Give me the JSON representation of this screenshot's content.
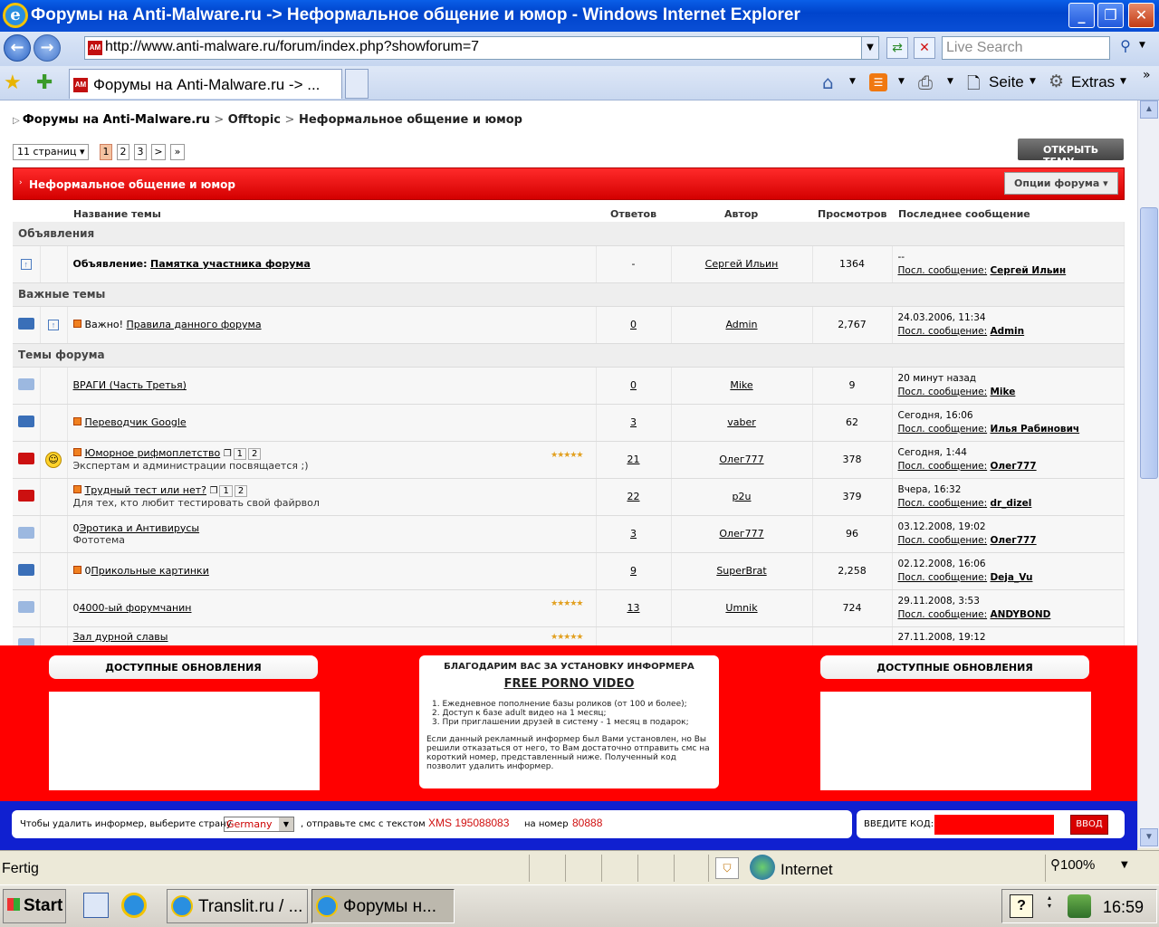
{
  "window": {
    "title": "Форумы на Anti-Malware.ru -> Неформальное общение и юмор - Windows Internet Explorer"
  },
  "address": {
    "url": "http://www.anti-malware.ru/forum/index.php?showforum=7",
    "search_placeholder": "Live Search"
  },
  "tabs": {
    "active": "Форумы на Anti-Malware.ru -> ..."
  },
  "commandbar": {
    "page": "Seite",
    "tools": "Extras"
  },
  "breadcrumb": {
    "root": "Форумы на Anti-Malware.ru",
    "sep": ">",
    "mid": "Offtopic",
    "current": "Неформальное общение и юмор"
  },
  "pagination": {
    "pages": "11 страниц",
    "items": [
      "1",
      "2",
      "3",
      ">",
      "»"
    ]
  },
  "new_topic": "ОТКРЫТЬ ТЕМУ",
  "forum": {
    "title": "Неформальное общение и юмор",
    "options": "Опции форума"
  },
  "columns": {
    "topic": "Название темы",
    "replies": "Ответов",
    "author": "Автор",
    "views": "Просмотров",
    "last": "Последнее сообщение"
  },
  "sections": {
    "announce": "Объявления",
    "important": "Важные темы",
    "topics": "Темы форума"
  },
  "last_label": "Посл. сообщение:",
  "announcement": {
    "prefix": "Объявление:",
    "title": "Памятка участника форума",
    "replies": "-",
    "author": "Сергей Ильин",
    "views": "1364",
    "date": "--",
    "last_by": "Сергей Ильин"
  },
  "pinned": {
    "prefix": "Важно!",
    "title": "Правила данного форума",
    "replies": "0",
    "author": "Admin",
    "views": "2,767",
    "date": "24.03.2006, 11:34",
    "last_by": "Admin"
  },
  "topics": [
    {
      "title": "ВРАГИ (Часть Третья)",
      "sub": "",
      "replies": "0",
      "author": "Mike",
      "views": "9",
      "date": "20 минут назад",
      "last_by": "Mike"
    },
    {
      "title": "Переводчик Google",
      "sub": "",
      "replies": "3",
      "author": "vaber",
      "views": "62",
      "date": "Сегодня, 16:06",
      "last_by": "Илья Рабинович"
    },
    {
      "title": "Юморное рифмоплетство",
      "sub": "Экспертам и администрации посвящается ;)",
      "replies": "21",
      "author": "Олег777",
      "views": "378",
      "date": "Сегодня, 1:44",
      "last_by": "Олег777",
      "pages": [
        "1",
        "2"
      ]
    },
    {
      "title": "Трудный тест или нет?",
      "sub": "Для тех, кто любит тестировать свой файрвол",
      "replies": "22",
      "author": "p2u",
      "views": "379",
      "date": "Вчера, 16:32",
      "last_by": "dr_dizel",
      "pages": [
        "1",
        "2"
      ]
    },
    {
      "title": "Эротика и Антивирусы",
      "sub": "Фототема",
      "replies": "3",
      "author": "Олег777",
      "views": "96",
      "date": "03.12.2008, 19:02",
      "last_by": "Олег777"
    },
    {
      "title": "Прикольные картинки",
      "sub": "",
      "replies": "9",
      "author": "SuperBrat",
      "views": "2,258",
      "date": "02.12.2008, 16:06",
      "last_by": "Deja_Vu"
    },
    {
      "title": "4000-ый форумчанин",
      "sub": "",
      "replies": "13",
      "author": "Umnik",
      "views": "724",
      "date": "29.11.2008, 3:53",
      "last_by": "ANDYBOND"
    },
    {
      "title": "Зал дурной славы",
      "sub": "",
      "replies": "",
      "author": "",
      "views": "",
      "date": "27.11.2008, 19:12",
      "last_by": ""
    }
  ],
  "informer": {
    "left_title": "ДОСТУПНЫЕ ОБНОВЛЕНИЯ",
    "right_title": "ДОСТУПНЫЕ ОБНОВЛЕНИЯ",
    "center_title": "БЛАГОДАРИМ ВАС ЗА УСТАНОВКУ ИНФОРМЕРА",
    "center_link": "FREE PORNO VIDEO",
    "list": [
      "1. Ежедневное пополнение базы роликов (от 100 и более);",
      "2. Доступ к базе adult видео на 1 месяц;",
      "3. При приглашении друзей в систему - 1 месяц в подарок;"
    ],
    "text": "Если данный рекламный информер был Вами установлен, но Вы решили отказаться от него, то Вам достаточно отправить смс на короткий номер, представленный ниже. Полученный код позволит удалить информер.",
    "select_label": "Чтобы удалить информер, выберите страну",
    "country": "Germany",
    "send_label": ", отправьте смс с текстом",
    "sms_text": "XMS 195088083",
    "number_label": "на номер",
    "number": "80888",
    "code_label": "ВВЕДИТЕ КОД:",
    "submit": "ВВОД"
  },
  "status": {
    "text": "Fertig",
    "zone": "Internet",
    "zoom": "100%"
  },
  "taskbar": {
    "start": "Start",
    "task1": "Translit.ru / ...",
    "task2": "Форумы н...",
    "time": "16:59"
  }
}
